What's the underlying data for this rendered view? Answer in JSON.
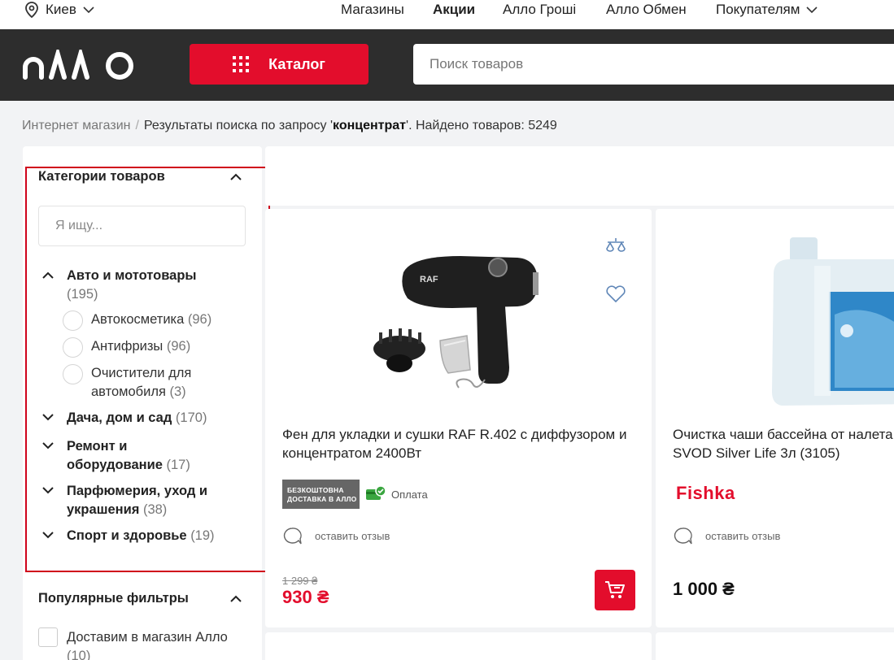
{
  "topbar": {
    "city": "Киев",
    "nav": [
      "Магазины",
      "Акции",
      "Алло Гроші",
      "Алло Обмен",
      "Покупателям"
    ]
  },
  "header": {
    "catalog_label": "Каталог",
    "search_placeholder": "Поиск товаров"
  },
  "breadcrumb": {
    "home": "Интернет магазин",
    "separator": "/",
    "prefix": "Результаты поиска по запросу '",
    "query": "концентрат",
    "suffix": "'. Найдено товаров: 5249"
  },
  "sidebar": {
    "categories_title": "Категории товаров",
    "search_placeholder": "Я ищу...",
    "categories": [
      {
        "name": "Авто и мототовары",
        "count": "(195)",
        "expanded": true,
        "subs": [
          {
            "name": "Автокосметика",
            "count": "(96)"
          },
          {
            "name": "Антифризы",
            "count": "(96)"
          },
          {
            "name": "Очистители для автомобиля",
            "count": "(3)"
          }
        ]
      },
      {
        "name": "Дача, дом и сад",
        "count": "(170)"
      },
      {
        "name": "Ремонт и оборудование",
        "count": "(17)"
      },
      {
        "name": "Парфюмерия, уход и украшения",
        "count": "(38)"
      },
      {
        "name": "Спорт и здоровье",
        "count": "(19)"
      }
    ],
    "popular_title": "Популярные фильтры",
    "popular_items": [
      {
        "name": "Доставим в магазин Алло",
        "count": "(10)"
      }
    ]
  },
  "products": [
    {
      "title": "Фен для укладки и сушки RAF R.402 с диффузором и концентратом 2400Вт",
      "badge": "БЕЗКОШТОВНА ДОСТАВКА В АЛЛО",
      "payment": "Оплата",
      "review": "оставить отзыв",
      "old_price": "1 299 ₴",
      "price": "930 ₴"
    },
    {
      "title": "Очистка чаши бассейна от налета SVOD Silver Life 3л (3105)",
      "brand": "Fishka",
      "review": "оставить отзыв",
      "price": "1 000 ₴"
    }
  ],
  "colors": {
    "accent": "#e30d2c",
    "header_bg": "#2d2d2d",
    "highlight": "#d0021b"
  }
}
